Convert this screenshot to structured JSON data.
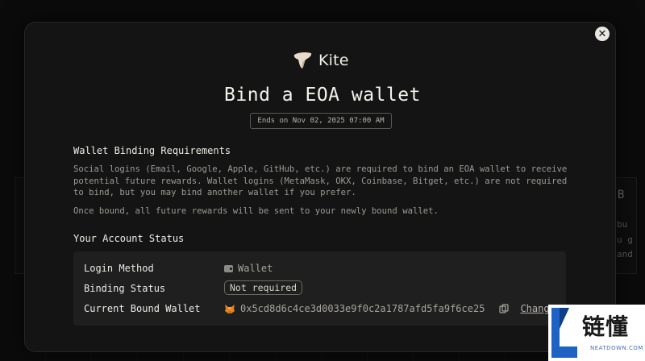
{
  "background": {
    "peek_title": "o B",
    "peek_lines": [
      "bu",
      "u g",
      "and"
    ]
  },
  "modal": {
    "brand": "Kite",
    "title": "Bind a EOA wallet",
    "ends_badge": "Ends on Nov 02, 2025 07:00 AM",
    "close_icon": "close-icon"
  },
  "requirements": {
    "heading": "Wallet Binding Requirements",
    "paragraph1": "Social logins (Email, Google, Apple, GitHub, etc.) are required to bind an EOA wallet to receive potential future rewards. Wallet logins (MetaMask, OKX, Coinbase, Bitget, etc.) are not required to bind, but you may bind another wallet if you prefer.",
    "paragraph2": "Once bound, all future rewards will be sent to your newly bound wallet."
  },
  "account_status": {
    "heading": "Your Account Status",
    "login_method_label": "Login Method",
    "login_method_value": "Wallet",
    "binding_status_label": "Binding Status",
    "binding_status_value": "Not required",
    "current_wallet_label": "Current Bound Wallet",
    "current_wallet_address": "0x5cd8d6c4ce3d0033e9f0c2a1787afd5fa9f6ce25",
    "change_label": "Change"
  },
  "watermark": {
    "text": "链懂",
    "sub": "NEATDOWN.COM"
  },
  "colors": {
    "background": "#0b0b0b",
    "modal": "#141414",
    "status_box": "#1f1f1f",
    "text_primary": "#eeece6",
    "text_muted": "#9d9a93"
  }
}
